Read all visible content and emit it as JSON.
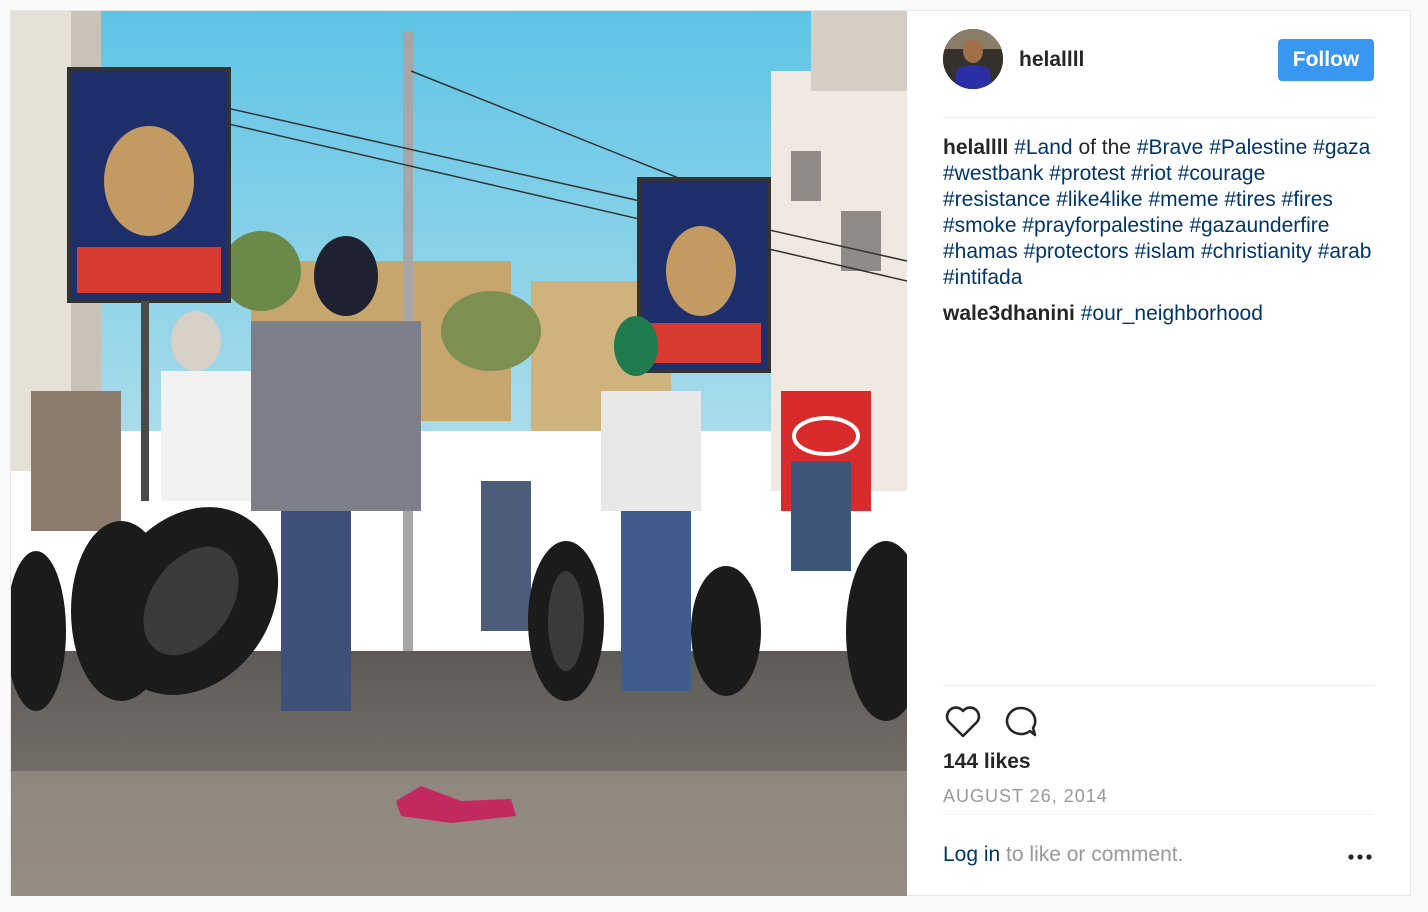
{
  "post": {
    "author": "helallll",
    "follow_label": "Follow",
    "caption": {
      "author": "helallll",
      "parts": [
        {
          "t": "tag",
          "v": "#Land"
        },
        {
          "t": "plain",
          "v": " of the "
        },
        {
          "t": "tag",
          "v": "#Brave"
        },
        {
          "t": "plain",
          "v": " "
        },
        {
          "t": "tag",
          "v": "#Palestine"
        },
        {
          "t": "plain",
          "v": " "
        },
        {
          "t": "tag",
          "v": "#gaza"
        },
        {
          "t": "plain",
          "v": " "
        },
        {
          "t": "tag",
          "v": "#westbank"
        },
        {
          "t": "plain",
          "v": " "
        },
        {
          "t": "tag",
          "v": "#protest"
        },
        {
          "t": "plain",
          "v": " "
        },
        {
          "t": "tag",
          "v": "#riot"
        },
        {
          "t": "plain",
          "v": " "
        },
        {
          "t": "tag",
          "v": "#courage"
        },
        {
          "t": "plain",
          "v": " "
        },
        {
          "t": "tag",
          "v": "#resistance"
        },
        {
          "t": "plain",
          "v": " "
        },
        {
          "t": "tag",
          "v": "#like4like"
        },
        {
          "t": "plain",
          "v": " "
        },
        {
          "t": "tag",
          "v": "#meme"
        },
        {
          "t": "plain",
          "v": " "
        },
        {
          "t": "tag",
          "v": "#tires"
        },
        {
          "t": "plain",
          "v": " "
        },
        {
          "t": "tag",
          "v": "#fires"
        },
        {
          "t": "plain",
          "v": " "
        },
        {
          "t": "tag",
          "v": "#smoke"
        },
        {
          "t": "plain",
          "v": " "
        },
        {
          "t": "tag",
          "v": "#prayforpalestine"
        },
        {
          "t": "plain",
          "v": " "
        },
        {
          "t": "tag",
          "v": "#gazaunderfire"
        },
        {
          "t": "plain",
          "v": " "
        },
        {
          "t": "tag",
          "v": "#hamas"
        },
        {
          "t": "plain",
          "v": " "
        },
        {
          "t": "tag",
          "v": "#protectors"
        },
        {
          "t": "plain",
          "v": " "
        },
        {
          "t": "tag",
          "v": "#islam"
        },
        {
          "t": "plain",
          "v": " "
        },
        {
          "t": "tag",
          "v": "#christianity"
        },
        {
          "t": "plain",
          "v": " "
        },
        {
          "t": "tag",
          "v": "#arab"
        },
        {
          "t": "plain",
          "v": " "
        },
        {
          "t": "tag",
          "v": "#intifada"
        }
      ]
    },
    "comment": {
      "author": "wale3dhanini",
      "text": "#our_neighborhood"
    },
    "likes": "144 likes",
    "date": "AUGUST 26, 2014",
    "login_link": "Log in",
    "login_rest": " to like or comment.",
    "icons": {
      "like": "heart-icon",
      "comment": "speech-bubble-icon",
      "more": "ellipsis-icon"
    },
    "colors": {
      "follow_bg": "#3897f0",
      "hashtag": "#003569",
      "muted": "#999999"
    }
  }
}
